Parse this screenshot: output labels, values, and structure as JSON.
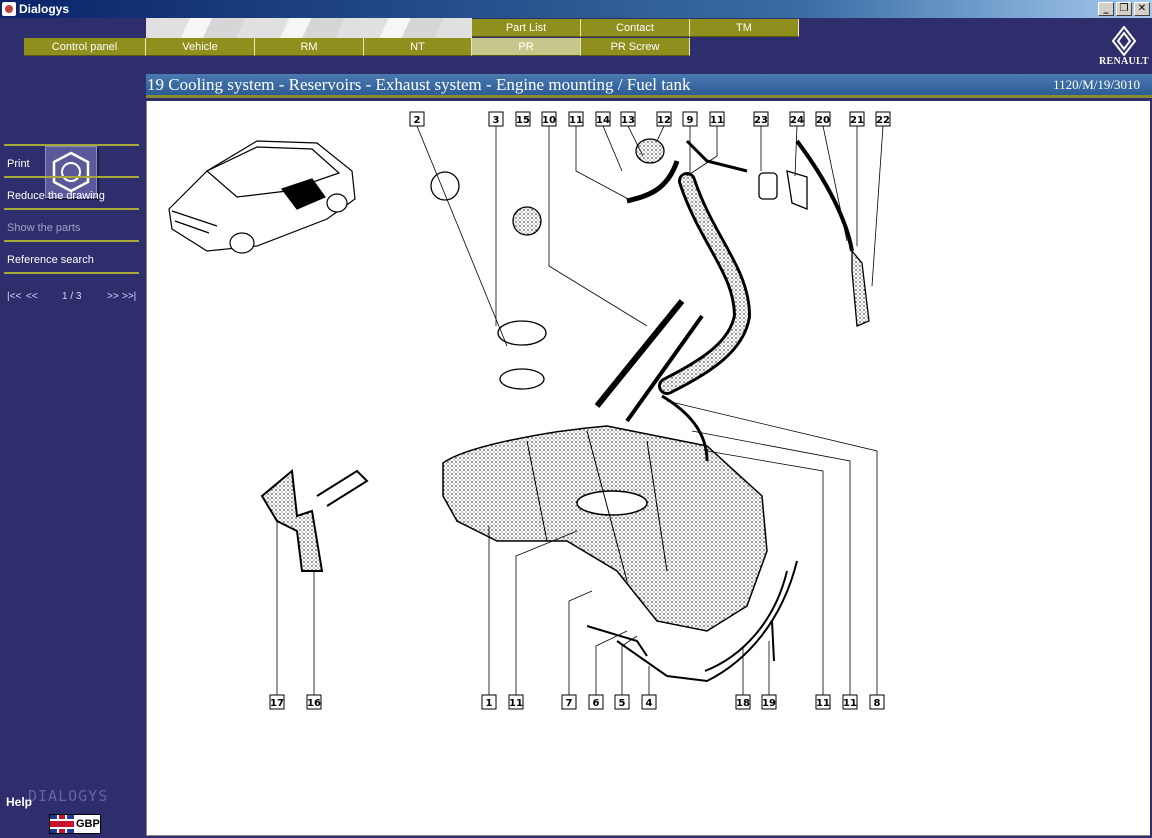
{
  "window": {
    "title": "Dialogys"
  },
  "tabs_top": [
    {
      "label": "Part List"
    },
    {
      "label": "Contact"
    },
    {
      "label": "TM"
    }
  ],
  "tabs_bottom": [
    {
      "label": "Control panel"
    },
    {
      "label": "Vehicle"
    },
    {
      "label": "RM"
    },
    {
      "label": "NT"
    },
    {
      "label": "PR",
      "active": true
    },
    {
      "label": "PR Screw"
    }
  ],
  "brand": {
    "name": "RENAULT"
  },
  "sidebar": {
    "items": [
      {
        "label": "Print",
        "enabled": true
      },
      {
        "label": "Reduce the drawing",
        "enabled": true
      },
      {
        "label": "Show the parts",
        "enabled": false
      },
      {
        "label": "Reference search",
        "enabled": true
      }
    ],
    "pager": {
      "first": "|<<",
      "prev": "<<",
      "page": "1 / 3",
      "next": ">>",
      "last": ">>|"
    },
    "help_label": "Help",
    "mark": "DIALOGYS",
    "currency": "GBP"
  },
  "document": {
    "title": "19 Cooling system - Reservoirs - Exhaust system - Engine mounting / Fuel tank",
    "reference": "1120/M/19/3010"
  },
  "callouts_top": [
    "2",
    "3",
    "15",
    "10",
    "11",
    "14",
    "13",
    "12",
    "9",
    "11",
    "23",
    "24",
    "20",
    "21",
    "22"
  ],
  "callouts_bottom": [
    "17",
    "16",
    "1",
    "11",
    "7",
    "6",
    "5",
    "4",
    "18",
    "19",
    "11",
    "11",
    "8"
  ],
  "colors": {
    "sidebar_bg": "#2e2e6c",
    "tab_olive": "#8f8f1e",
    "tab_active": "#c7c78c",
    "header_blue": "#3a6aa4"
  }
}
